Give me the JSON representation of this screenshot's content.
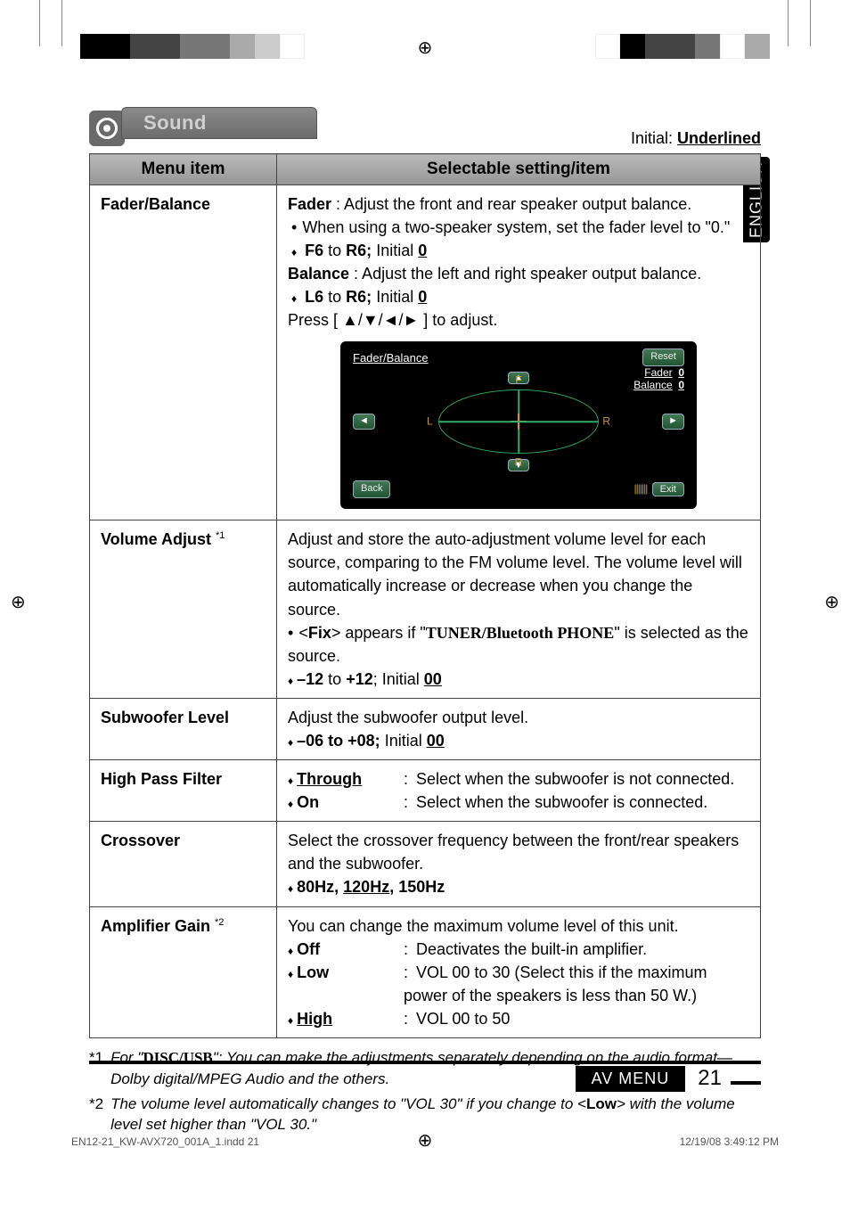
{
  "side_tab": "ENGLISH",
  "header": {
    "tab": "Sound",
    "initial_prefix": "Initial: ",
    "initial_value": "Underlined"
  },
  "columns": {
    "menu": "Menu item",
    "setting": "Selectable setting/item"
  },
  "rows": {
    "fader": {
      "name": "Fader/Balance",
      "fader_label": "Fader",
      "fader_desc": " : Adjust the front and rear speaker output balance.",
      "fader_note": "When using a two-speaker system, set the fader level to \"0.\"",
      "fader_range_pre": "F6",
      "fader_range_mid": " to ",
      "fader_range_post": "R6;",
      "initial_word": " Initial ",
      "fader_initial": "0",
      "balance_label": "Balance",
      "balance_desc": " : Adjust the left and right speaker output balance.",
      "balance_range_pre": "L6",
      "balance_range_post": "R6;",
      "balance_initial": "0",
      "press_line_pre": "Press [ ",
      "press_arrows": "▲/▼/◄/►",
      "press_line_post": " ] to adjust.",
      "screen": {
        "title": "Fader/Balance",
        "reset": "Reset",
        "fader_lbl": "Fader",
        "fader_val": "0",
        "balance_lbl": "Balance",
        "balance_val": "0",
        "F": "F",
        "R": "R",
        "L": "L",
        "Rt": "R",
        "back": "Back",
        "exit": "Exit",
        "vol": "|||||||"
      }
    },
    "voladj": {
      "name_pre": "Volume Adjust ",
      "name_sup": "*1",
      "desc": "Adjust and store the auto-adjustment volume level for each source, comparing to the FM volume level. The volume level will automatically increase or decrease when you change the source.",
      "fix_pre": "<",
      "fix": "Fix",
      "fix_post": "> appears if \"",
      "fix_serif": "TUNER/Bluetooth PHONE",
      "fix_end": "\" is selected as the source.",
      "range_pre": "–12",
      "range_mid": " to ",
      "range_post": "+12",
      "sep": "; Initial ",
      "initial": "00"
    },
    "sub": {
      "name": "Subwoofer Level",
      "desc": "Adjust the subwoofer output level.",
      "range": "–06 to +08;",
      "sep": " Initial ",
      "initial": "00"
    },
    "hpf": {
      "name": "High Pass Filter",
      "opt1": "Through",
      "desc1": "Select when the subwoofer is not connected.",
      "opt2": "On",
      "desc2": "Select when the subwoofer is connected."
    },
    "cross": {
      "name": "Crossover",
      "desc": "Select the crossover frequency between the front/rear speakers and the subwoofer.",
      "opts_pre": "80Hz, ",
      "opts_u": "120Hz",
      "opts_post": ", 150Hz"
    },
    "amp": {
      "name_pre": "Amplifier Gain ",
      "name_sup": "*2",
      "desc": "You can change the maximum volume level of this unit.",
      "opt1": "Off",
      "d1": "Deactivates the built-in amplifier.",
      "opt2": "Low",
      "d2": "VOL 00 to 30 (Select this if the maximum power of the speakers is less than 50 W.)",
      "opt3": "High",
      "d3": "VOL 00 to 50"
    }
  },
  "footnotes": {
    "n1": "*1",
    "f1_pre": "For \"",
    "f1_serif": "DISC/USB",
    "f1_post": "\": You can make the adjustments separately depending on the audio format—Dolby digital/MPEG Audio and the others.",
    "n2": "*2",
    "f2_pre": "The volume level automatically changes to \"VOL 30\" if you change to <",
    "f2_b": "Low",
    "f2_post": "> with the volume level set higher than \"VOL 30.\""
  },
  "footer": {
    "section": "AV MENU",
    "page": "21"
  },
  "printline": {
    "file": "EN12-21_KW-AVX720_001A_1.indd   21",
    "ts": "12/19/08   3:49:12 PM"
  }
}
